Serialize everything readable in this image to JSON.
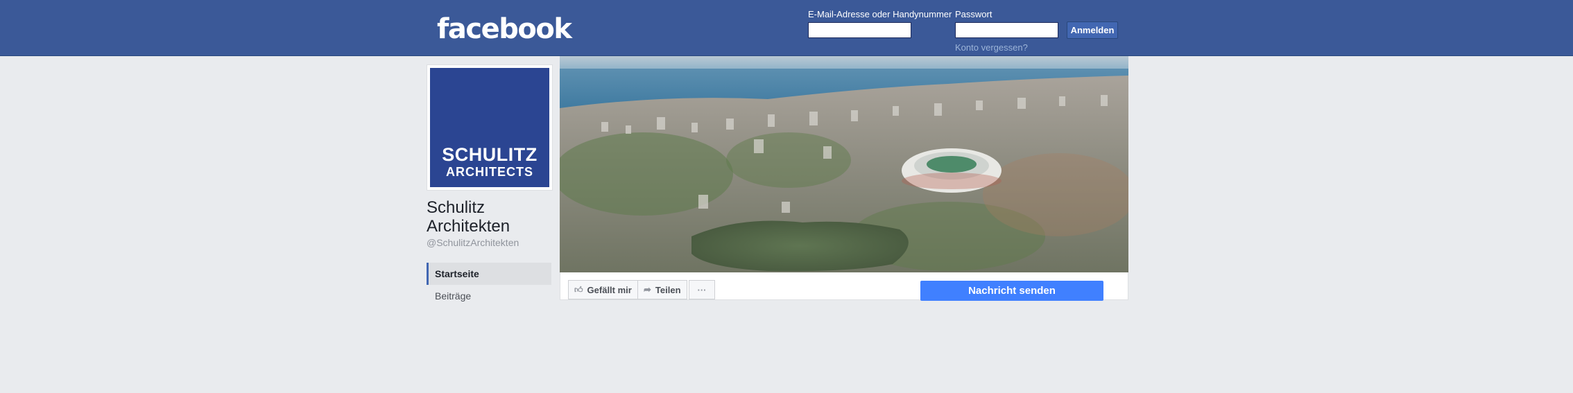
{
  "header": {
    "logo": "facebook",
    "email_label": "E-Mail-Adresse oder Handynummer",
    "email_value": "",
    "password_label": "Passwort",
    "password_value": "",
    "login_button": "Anmelden",
    "forgot_link": "Konto vergessen?"
  },
  "page": {
    "logo_line1": "SCHULITZ",
    "logo_line2": "ARCHITECTS",
    "name": "Schulitz Architekten",
    "handle": "@SchulitzArchitekten"
  },
  "nav": {
    "items": [
      {
        "label": "Startseite",
        "active": true
      },
      {
        "label": "Beiträge",
        "active": false
      }
    ]
  },
  "cover": {
    "icon": "city-aerial-stadium-image"
  },
  "actions": {
    "like": "Gefällt mir",
    "share": "Teilen",
    "more": "···",
    "message": "Nachricht senden"
  },
  "colors": {
    "header_bg": "#3b5998",
    "primary_button": "#4080ff",
    "page_bg": "#e9ebee"
  }
}
